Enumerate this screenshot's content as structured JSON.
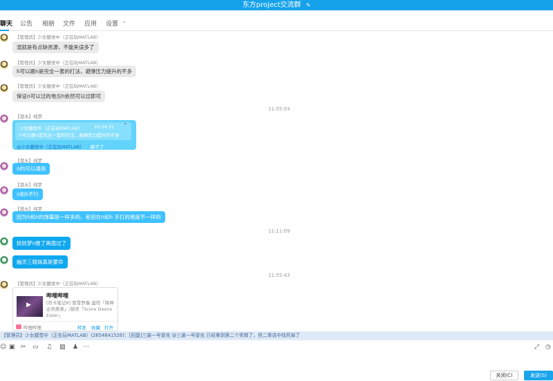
{
  "window": {
    "title": "东方project交流群",
    "edit_icon": "✎"
  },
  "tabs": [
    "聊天",
    "公告",
    "相册",
    "文件",
    "应用",
    "设置"
  ],
  "settings_chevron": "⌄",
  "names": {
    "admin": "【管理员】少女膳觉中（正在玩MATLAB）",
    "cxm1": "【潜水】纯梦",
    "cxm2": "【潜水】纯梦",
    "cxm3": "【潜水】纯梦",
    "cxm4": "【潜水】纯梦"
  },
  "messages": {
    "m1": "混就是有点缺资源，不能失误多了",
    "m2": "h可以跟n是完全一套的打法，避弹压力提升的不多",
    "m3": "保证n可以过的地方h依然可以过即可",
    "m5": "n的可以通用",
    "m6": "n和h不行",
    "m7": "因为h和n的弹幕是一样多的，差别在n和h 手打的难度不一样的",
    "m8": "妖妖梦n推了两面过了",
    "m9": "幽灵三姐妹真是要命"
  },
  "times": {
    "t1": "11:05:03",
    "t2": "11:11:09",
    "t3": "11:55:43"
  },
  "quote": {
    "header": "少女膳觉中（正在玩MATLAB）",
    "time": "10:34:31",
    "body": "h可以跟n是完全一套的打法，避弹压力提升的不多",
    "mention": "@少女膳觉中（正在玩MATLAB）",
    "tail": "解不了",
    "close_icon": "⌃"
  },
  "card": {
    "title": "哔哩哔哩",
    "desc": "[符卡笔记8] 冒雪罗春 盗符「降神必灵原来」/部灵「Score Desire Eater」",
    "source": "哔哩哔哩",
    "actions": [
      "转发",
      "收藏",
      "打开"
    ]
  },
  "announcement": "【管理员】少女膳觉中（正在玩MATLAB）(2654841526)：[回复]三装一号冒充 @三装一号冒充 已经拿到第二个奖牌了，但二哥说中找死掉了",
  "toolbar_icons": [
    "☺",
    "▣",
    "✂",
    "▭",
    "♫",
    "▨",
    "♟",
    "⋯"
  ],
  "expand_icon": "⤢",
  "history_icon": "◷",
  "buttons": {
    "close": "关闭(C)",
    "send": "发送(S)"
  }
}
